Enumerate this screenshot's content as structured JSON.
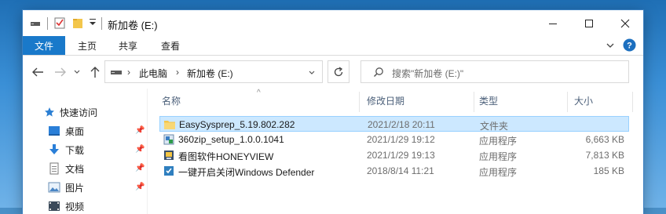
{
  "titlebar": {
    "title": "新加卷 (E:)",
    "minimize_glyph": "—",
    "maximize_glyph": "☐",
    "close_glyph": "✕"
  },
  "ribbon": {
    "tabs": [
      "文件",
      "主页",
      "共享",
      "查看"
    ],
    "expand_glyph": "⌄",
    "help_glyph": "?"
  },
  "address": {
    "crumbs": [
      "此电脑",
      "新加卷 (E:)"
    ],
    "chevron": "›",
    "dropdown_glyph": "⌄",
    "search_placeholder": "搜索\"新加卷 (E:)\""
  },
  "nav": {
    "quick_access": "快速访问",
    "items": [
      {
        "label": "桌面",
        "icon": "desktop-icon"
      },
      {
        "label": "下载",
        "icon": "download-icon"
      },
      {
        "label": "文档",
        "icon": "document-icon"
      },
      {
        "label": "图片",
        "icon": "picture-icon"
      },
      {
        "label": "视频",
        "icon": "video-icon"
      }
    ]
  },
  "columns": {
    "name": "名称",
    "modified": "修改日期",
    "type": "类型",
    "size": "大小",
    "sort_glyph": "^"
  },
  "files": [
    {
      "name": "EasySysprep_5.19.802.282",
      "modified": "2021/2/18 20:11",
      "type": "文件夹",
      "size": "",
      "icon": "folder-icon",
      "selected": true
    },
    {
      "name": "360zip_setup_1.0.0.1041",
      "modified": "2021/1/29 19:12",
      "type": "应用程序",
      "size": "6,663 KB",
      "icon": "installer-icon",
      "selected": false
    },
    {
      "name": "看图软件HONEYVIEW",
      "modified": "2021/1/29 19:13",
      "type": "应用程序",
      "size": "7,813 KB",
      "icon": "honeyview-icon",
      "selected": false
    },
    {
      "name": "一键开启关闭Windows Defender",
      "modified": "2018/8/14 11:21",
      "type": "应用程序",
      "size": "185 KB",
      "icon": "defender-tool-icon",
      "selected": false
    }
  ],
  "colors": {
    "accent": "#1979ca",
    "selection": "#cce8ff",
    "folder": "#f3c64b"
  }
}
